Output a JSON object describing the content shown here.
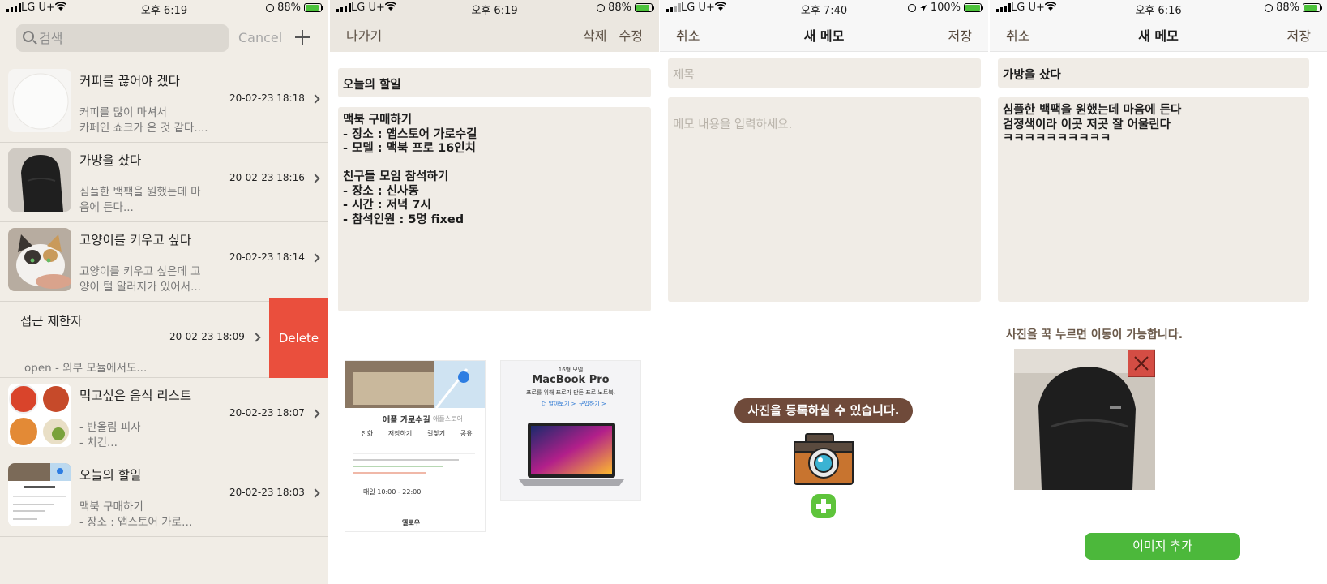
{
  "status_bars": [
    {
      "carrier": "LG U+",
      "time": "오후 6:19",
      "battery": "88%",
      "battery_level": 0.88
    },
    {
      "carrier": "LG U+",
      "time": "오후 6:19",
      "battery": "88%",
      "battery_level": 0.88
    },
    {
      "carrier": "LG U+",
      "time": "오후 7:40",
      "battery": "100%",
      "battery_level": 1.0
    },
    {
      "carrier": "LG U+",
      "time": "오후 6:16",
      "battery": "88%",
      "battery_level": 0.88
    }
  ],
  "list": {
    "search_placeholder": "검색",
    "cancel_label": "Cancel",
    "memos": [
      {
        "title": "커피를 끊어야 겠다",
        "preview": "커피를 많이 마셔서\n카페인 쇼크가 온 것 같다....",
        "date": "20-02-23 18:18"
      },
      {
        "title": "가방을 샀다",
        "preview": "심플한 백팩을 원했는데 마음에 든다...",
        "date": "20-02-23 18:16"
      },
      {
        "title": "고양이를 키우고 싶다",
        "preview": "고양이를 키우고 싶은데 고양이 털 알러지가 있어서...",
        "date": "20-02-23 18:14"
      },
      {
        "title": "먹고싶은 음식 리스트",
        "preview": "- 반올림 피자\n- 치킨...",
        "date": "20-02-23 18:07"
      },
      {
        "title": "오늘의 할일",
        "preview": "맥북 구매하기\n- 장소 : 앱스토어 가로…",
        "date": "20-02-23 18:03"
      }
    ],
    "swiped_memo": {
      "title": "접근 제한자",
      "preview": "open - 외부 모듈에서도...",
      "date": "20-02-23 18:09"
    },
    "delete_label": "Delete"
  },
  "detail": {
    "back_label": "나가기",
    "delete_label": "삭제",
    "edit_label": "수정",
    "title": "오늘의 할일",
    "body": "맥북 구매하기\n- 장소 : 앱스토어 가로수길\n- 모델 : 맥북 프로 16인치\n\n친구들 모임 참석하기\n- 장소 : 신사동\n- 시간 : 저녁 7시\n- 참석인원 : 5명 fixed",
    "map_card": {
      "place": "애플 가로수길",
      "category": "애플스토어",
      "actions": [
        "전화",
        "저장하기",
        "길찾기",
        "공유"
      ],
      "hours": "매일 10:00 - 22:00",
      "next": "엘로우"
    },
    "mac_card": {
      "tag": "16형 모델",
      "name": "MacBook Pro",
      "tagline": "프로를 위해 프로가 만든 프로 노트북.",
      "link1": "더 알아보기 >",
      "link2": "구입하기 >"
    }
  },
  "new_memo_empty": {
    "cancel_label": "취소",
    "title": "새 메모",
    "save_label": "저장",
    "title_placeholder": "제목",
    "body_placeholder": "메모 내용을 입력하세요.",
    "photo_hint": "사진을 등록하실 수 있습니다."
  },
  "new_memo_filled": {
    "cancel_label": "취소",
    "title": "새 메모",
    "save_label": "저장",
    "memo_title": "가방을 샀다",
    "memo_body": "심플한 백팩을 원했는데 마음에 든다\n검정색이라 이곳 저곳 잘 어울린다\nㅋㅋㅋㅋㅋㅋㅋㅋㅋㅋ",
    "move_hint": "사진을 꾹 누르면 이동이 가능합니다.",
    "add_image_label": "이미지 추가"
  },
  "colors": {
    "accent_brown": "#6f4a3a",
    "delete_red": "#ea4f3d",
    "add_green": "#4cb83b",
    "bg_beige": "#f1ede6"
  }
}
